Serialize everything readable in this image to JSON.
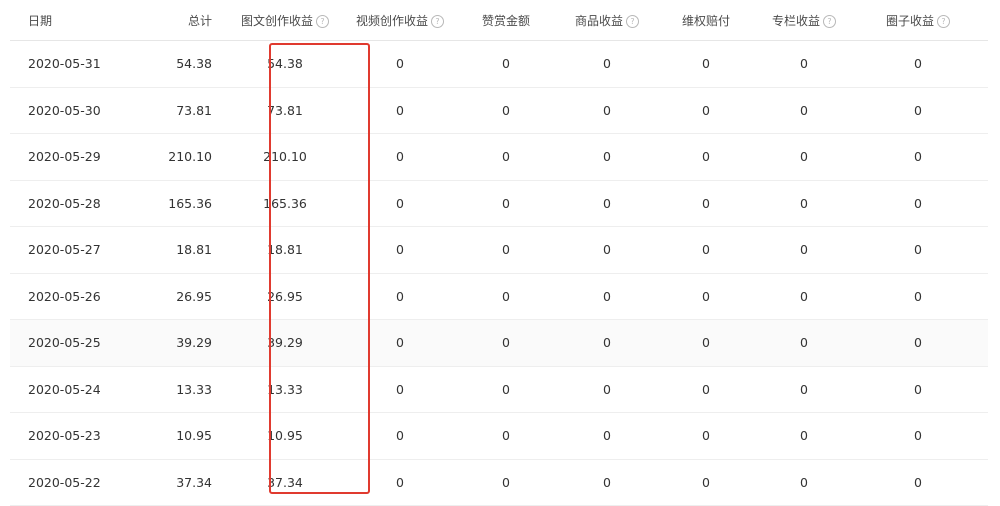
{
  "columns": [
    {
      "label": "日期",
      "help": false
    },
    {
      "label": "总计",
      "help": false
    },
    {
      "label": "图文创作收益",
      "help": true
    },
    {
      "label": "视频创作收益",
      "help": true
    },
    {
      "label": "赞赏金额",
      "help": false
    },
    {
      "label": "商品收益",
      "help": true
    },
    {
      "label": "维权赔付",
      "help": false
    },
    {
      "label": "专栏收益",
      "help": true
    },
    {
      "label": "圈子收益",
      "help": true
    }
  ],
  "help_glyph": "?",
  "rows": [
    [
      "2020-05-31",
      "54.38",
      "54.38",
      "0",
      "0",
      "0",
      "0",
      "0",
      "0"
    ],
    [
      "2020-05-30",
      "73.81",
      "73.81",
      "0",
      "0",
      "0",
      "0",
      "0",
      "0"
    ],
    [
      "2020-05-29",
      "210.10",
      "210.10",
      "0",
      "0",
      "0",
      "0",
      "0",
      "0"
    ],
    [
      "2020-05-28",
      "165.36",
      "165.36",
      "0",
      "0",
      "0",
      "0",
      "0",
      "0"
    ],
    [
      "2020-05-27",
      "18.81",
      "18.81",
      "0",
      "0",
      "0",
      "0",
      "0",
      "0"
    ],
    [
      "2020-05-26",
      "26.95",
      "26.95",
      "0",
      "0",
      "0",
      "0",
      "0",
      "0"
    ],
    [
      "2020-05-25",
      "39.29",
      "39.29",
      "0",
      "0",
      "0",
      "0",
      "0",
      "0"
    ],
    [
      "2020-05-24",
      "13.33",
      "13.33",
      "0",
      "0",
      "0",
      "0",
      "0",
      "0"
    ],
    [
      "2020-05-23",
      "10.95",
      "10.95",
      "0",
      "0",
      "0",
      "0",
      "0",
      "0"
    ],
    [
      "2020-05-22",
      "37.34",
      "37.34",
      "0",
      "0",
      "0",
      "0",
      "0",
      "0"
    ]
  ],
  "highlight_color": "#e03a2f",
  "highlighted_column": "图文创作收益"
}
